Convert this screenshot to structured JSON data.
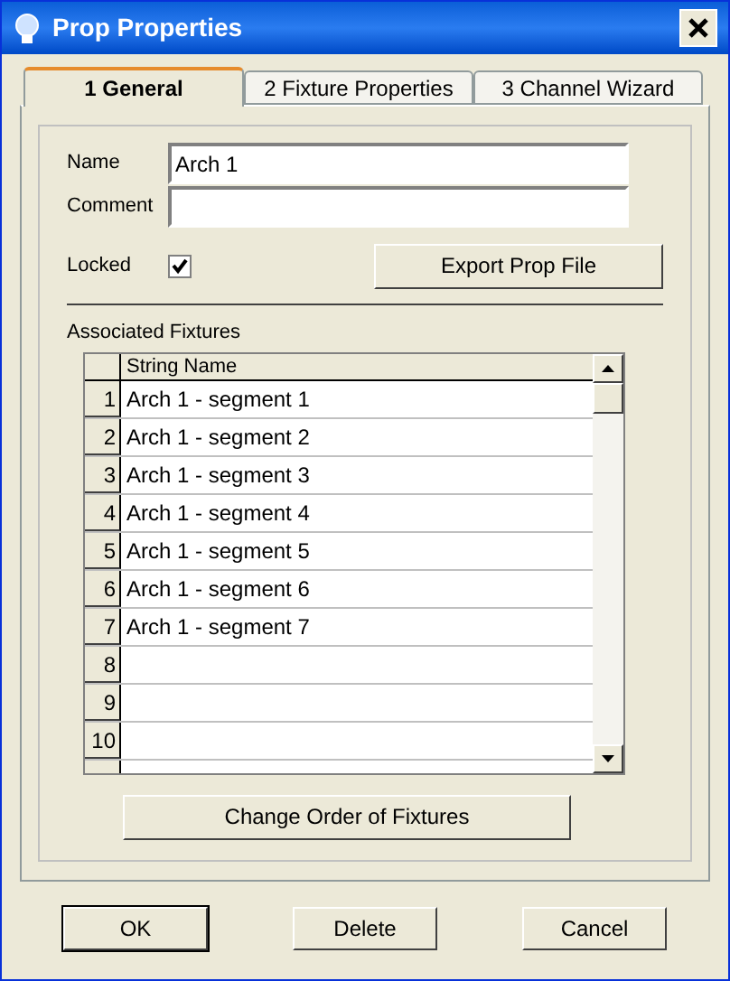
{
  "window": {
    "title": "Prop Properties"
  },
  "tabs": [
    {
      "label": "1 General",
      "selected": true
    },
    {
      "label": "2 Fixture Properties",
      "selected": false
    },
    {
      "label": "3 Channel Wizard",
      "selected": false
    }
  ],
  "name_field": {
    "label": "Name",
    "value": "Arch 1"
  },
  "comment_field": {
    "label": "Comment"
  },
  "locked": {
    "label": "Locked",
    "checked": true
  },
  "export_button": "Export Prop File",
  "fixtures": {
    "label": "Associated Fixtures",
    "columns": [
      "String Name"
    ],
    "rows": [
      {
        "number": "1",
        "string_name": "Arch 1 - segment 1"
      },
      {
        "number": "2",
        "string_name": "Arch 1 - segment 2"
      },
      {
        "number": "3",
        "string_name": "Arch 1 - segment 3"
      },
      {
        "number": "4",
        "string_name": "Arch 1 - segment 4"
      },
      {
        "number": "5",
        "string_name": "Arch 1 - segment 5"
      },
      {
        "number": "6",
        "string_name": "Arch 1 - segment 6"
      },
      {
        "number": "7",
        "string_name": "Arch 1 - segment 7"
      },
      {
        "number": "8"
      },
      {
        "number": "9"
      },
      {
        "number": "10"
      }
    ]
  },
  "change_order_button": "Change Order of Fixtures",
  "buttons": [
    "OK",
    "Delete",
    "Cancel"
  ]
}
